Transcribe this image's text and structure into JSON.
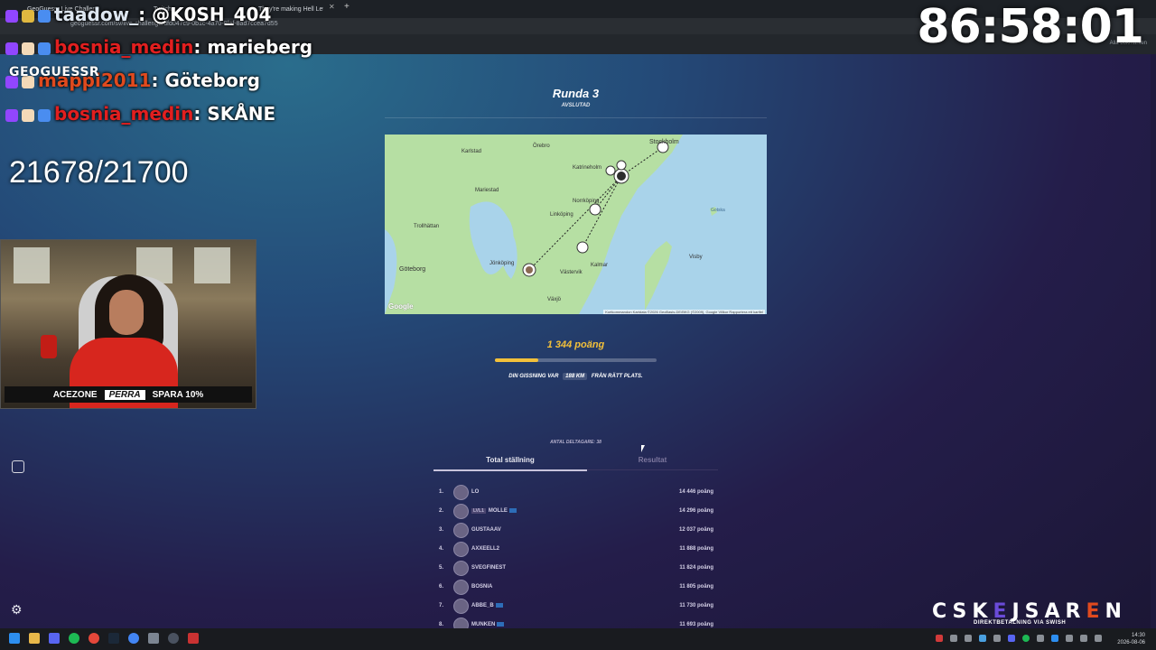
{
  "browser": {
    "tabs": [
      "GeoGuessr Live Challenge",
      "Twitch",
      "They're making Hell Let..."
    ],
    "url": "geoguessr.com/sv/live-challenge/dfd047c9-0b1c-4a70-8faf-8ad7ccea7d55",
    "bookmarks_right": "Alla bokmärken"
  },
  "overlay": {
    "chat": [
      {
        "user": "taadow_",
        "text": "@K0SH_404",
        "color": "uname-gray"
      },
      {
        "user": "bosnia_medin",
        "text": "marieberg",
        "color": "uname-red"
      },
      {
        "user": "mappi2011",
        "text": "Göteborg",
        "color": "uname-orange"
      },
      {
        "user": "bosnia_medin",
        "text": "SKÅNE",
        "color": "uname-red"
      }
    ],
    "separator": ": ",
    "timer": "86:58:01",
    "score": "21678/21700",
    "geo_logo": "GEOGUESSR",
    "cam_banner": {
      "brand": "ACEZONE",
      "name": "PERRA",
      "discount": "SPARA 10%"
    },
    "sponsor": {
      "prefix": "CSK",
      "e1": "E",
      "mid": "JSAR",
      "e2": "E",
      "suffix": "N",
      "sub": "DIREKTBETALNING VIA SWISH"
    }
  },
  "round": {
    "title": "Runda 3",
    "status": "AVSLUTAD"
  },
  "map": {
    "labels": [
      "Stockholm",
      "Örebro",
      "Karlstad",
      "Katrineholm",
      "Norrköping",
      "Linköping",
      "Trollhättan",
      "Göteborg",
      "Jönköping",
      "Växjö",
      "Kalmar",
      "Västervik",
      "Visby",
      "Mariestad",
      "Gotska"
    ],
    "attribution": "Kortkommandon  Kartdata ©2026 GeoBasis-DE/BKG (©2009), Google  Villkor  Rapportera ett kartfel",
    "logo": "Google",
    "color_water": "#a9d3ea",
    "color_land": "#b6dfa3"
  },
  "result": {
    "points": "1 344 poäng",
    "progress": 0.27,
    "distance_prefix": "DIN GISSNING VAR",
    "distance": "188 KM",
    "distance_suffix": "FRÅN RÄTT PLATS."
  },
  "standings": {
    "participants": "ANTAL DELTAGARE: 38",
    "tabs": [
      "Total ställning",
      "Resultat"
    ],
    "rows": [
      {
        "rank": "1.",
        "name": "LO",
        "tag": "",
        "flag": false,
        "points": "14 446 poäng"
      },
      {
        "rank": "2.",
        "name": "MOLLE",
        "tag": "LVL1",
        "flag": true,
        "points": "14 296 poäng"
      },
      {
        "rank": "3.",
        "name": "GUSTAAAV",
        "tag": "",
        "flag": false,
        "points": "12 037 poäng"
      },
      {
        "rank": "4.",
        "name": "AXXEELL2",
        "tag": "",
        "flag": false,
        "points": "11 888 poäng"
      },
      {
        "rank": "5.",
        "name": "SVEGFINEST",
        "tag": "",
        "flag": false,
        "points": "11 824 poäng"
      },
      {
        "rank": "6.",
        "name": "BOSNIA",
        "tag": "",
        "flag": false,
        "points": "11 805 poäng"
      },
      {
        "rank": "7.",
        "name": "ABBE_B",
        "tag": "",
        "flag": true,
        "points": "11 730 poäng"
      },
      {
        "rank": "8.",
        "name": "MUNKEN",
        "tag": "",
        "flag": true,
        "points": "11 693 poäng"
      }
    ]
  },
  "taskbar": {
    "time": "14:30",
    "date": "2026-08-06"
  }
}
